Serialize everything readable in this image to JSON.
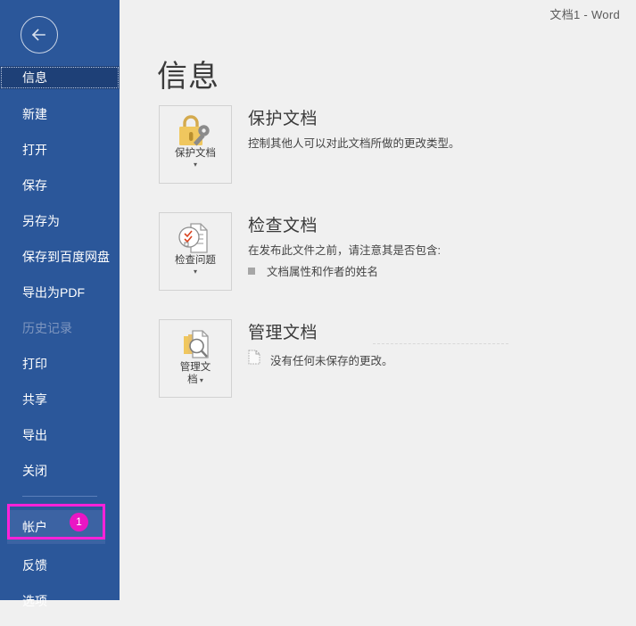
{
  "window": {
    "title": "文档1  -  Word"
  },
  "sidebar": {
    "back_label": "back-arrow",
    "items": [
      {
        "label": "信息",
        "state": "selected"
      },
      {
        "label": "新建",
        "state": "normal"
      },
      {
        "label": "打开",
        "state": "normal"
      },
      {
        "label": "保存",
        "state": "normal"
      },
      {
        "label": "另存为",
        "state": "normal"
      },
      {
        "label": "保存到百度网盘",
        "state": "normal"
      },
      {
        "label": "导出为PDF",
        "state": "normal"
      },
      {
        "label": "历史记录",
        "state": "disabled"
      },
      {
        "label": "打印",
        "state": "normal"
      },
      {
        "label": "共享",
        "state": "normal"
      },
      {
        "label": "导出",
        "state": "normal"
      },
      {
        "label": "关闭",
        "state": "normal"
      },
      {
        "label": "帐户",
        "state": "highlighted"
      },
      {
        "label": "反馈",
        "state": "normal"
      },
      {
        "label": "选项",
        "state": "normal"
      }
    ],
    "highlight": {
      "badge": "1",
      "box_color": "#ff22d8",
      "badge_color": "#ea16c4"
    },
    "background_color": "#2b579a",
    "selected_color": "#1e4077"
  },
  "main": {
    "page_title": "信息",
    "sections": [
      {
        "button_label": "保护文档",
        "button_icon": "lock-key-icon",
        "heading": "保护文档",
        "description": "控制其他人可以对此文档所做的更改类型。",
        "bullets": []
      },
      {
        "button_label": "检查问题",
        "button_icon": "document-check-icon",
        "heading": "检查文档",
        "description": "在发布此文件之前，请注意其是否包含:",
        "bullets": [
          "文档属性和作者的姓名"
        ]
      },
      {
        "button_label": "管理文\n档",
        "button_label_line1": "管理文",
        "button_label_line2": "档",
        "button_icon": "document-search-icon",
        "heading": "管理文档",
        "description": "没有任何未保存的更改。",
        "description_icon": "blank-document-icon",
        "bullets": []
      }
    ]
  }
}
